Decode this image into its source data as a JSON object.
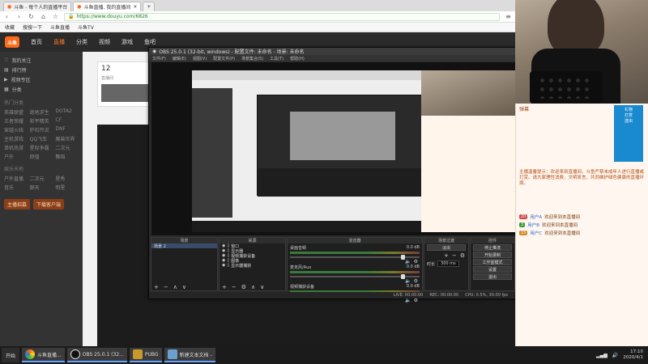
{
  "browser": {
    "tabs": [
      {
        "label": "斗鱼 - 每个人的直播平台",
        "icon": "douyu-icon"
      },
      {
        "label": "斗鱼直播, 我的直播间",
        "icon": "douyu-icon"
      }
    ],
    "new_tab": "+",
    "url": "https://www.douyu.com/6826",
    "bookmarks": [
      "收藏",
      "搜搜一下",
      "斗鱼直播",
      "斗鱼TV"
    ]
  },
  "site": {
    "logo": "斗鱼",
    "nav": [
      "首页",
      "直播",
      "分类",
      "视频",
      "游戏",
      "鱼吧"
    ],
    "active_nav": 1,
    "sidebar_top": [
      "我的关注",
      "排行榜",
      "视频专区",
      "分类"
    ],
    "sidebar_section": "热门分类",
    "sidebar_grid": [
      "英雄联盟",
      "绝地求生",
      "DOTA2",
      "王者荣耀",
      "和平精英",
      "CF",
      "穿越火线",
      "炉石传说",
      "DNF",
      "主机游戏",
      "QQ飞车",
      "魔兽世界",
      "单机热游",
      "星际争霸",
      "二次元",
      "户外",
      "颜值",
      "舞蹈"
    ],
    "sidebar_section2": "娱乐天地",
    "sidebar_grid2": [
      "户外直播",
      "二次元",
      "星秀",
      "音乐",
      "聊天",
      "明星"
    ],
    "sidebar_buttons": [
      "主播招募",
      "下载客户端"
    ],
    "room_count": "12",
    "room_title": "直播间"
  },
  "obs": {
    "title": "OBS 25.0.1 (32-bit, windows) - 配置文件: 未命名 - 场景: 未命名",
    "menu": [
      "文件(F)",
      "编辑(E)",
      "视图(V)",
      "配置文件(P)",
      "场景集合(S)",
      "工具(T)",
      "帮助(H)"
    ],
    "panels": {
      "scenes": {
        "title": "场景",
        "items": [
          "场景 2"
        ]
      },
      "sources": {
        "title": "来源",
        "items": [
          "窗口",
          "显示器",
          "视频捕获设备",
          "图像",
          "显示器捕获"
        ]
      },
      "mixer": {
        "title": "混音器",
        "channels": [
          {
            "name": "桌面音频",
            "db": "0.0 dB"
          },
          {
            "name": "麦克风/Aux",
            "db": "0.0 dB"
          },
          {
            "name": "视频捕获设备",
            "db": "0.0 dB"
          }
        ]
      },
      "transitions": {
        "title": "场景过渡",
        "type": "淡出",
        "duration_label": "时长",
        "duration": "300 ms"
      },
      "controls": {
        "title": "控件",
        "buttons": [
          "停止推流",
          "开始录制",
          "工作室模式",
          "设置",
          "退出"
        ]
      }
    },
    "status": [
      "LIVE: 00:00:00",
      "REC: 00:00:00",
      "CPU: 0.5%, 30.00 fps"
    ]
  },
  "chat": {
    "header": "弹幕",
    "notice": "主播温馨提示：欢迎来到直播间，斗鱼严禁未成年人进行直播或打赏。请大家理性消费，文明发言，共同维护绿色健康的直播环境。",
    "items": [
      {
        "badge": "20",
        "user": "用户A",
        "text": "欢迎来到本直播间"
      },
      {
        "badge": "3",
        "user": "用户B",
        "text": "欢迎来到本直播间"
      },
      {
        "badge": "15",
        "user": "用户C",
        "text": "欢迎来到本直播间"
      }
    ],
    "gift_banner": [
      "礼物",
      "打赏",
      "送出"
    ]
  },
  "taskbar": {
    "start": "开始",
    "items": [
      {
        "label": "斗鱼直播...",
        "icon": "browser-icon"
      },
      {
        "label": "OBS 25.0.1 (32...",
        "icon": "obs-icon"
      },
      {
        "label": "PUBG",
        "icon": "pubg-icon"
      },
      {
        "label": "新建文本文档 -",
        "icon": "notepad-icon"
      }
    ],
    "time": "17:10",
    "date": "2020/4/1"
  },
  "colors": {
    "accent": "#ff6a1a",
    "obs_bg": "#2a2a2a",
    "chat_text": "#b04a10"
  }
}
